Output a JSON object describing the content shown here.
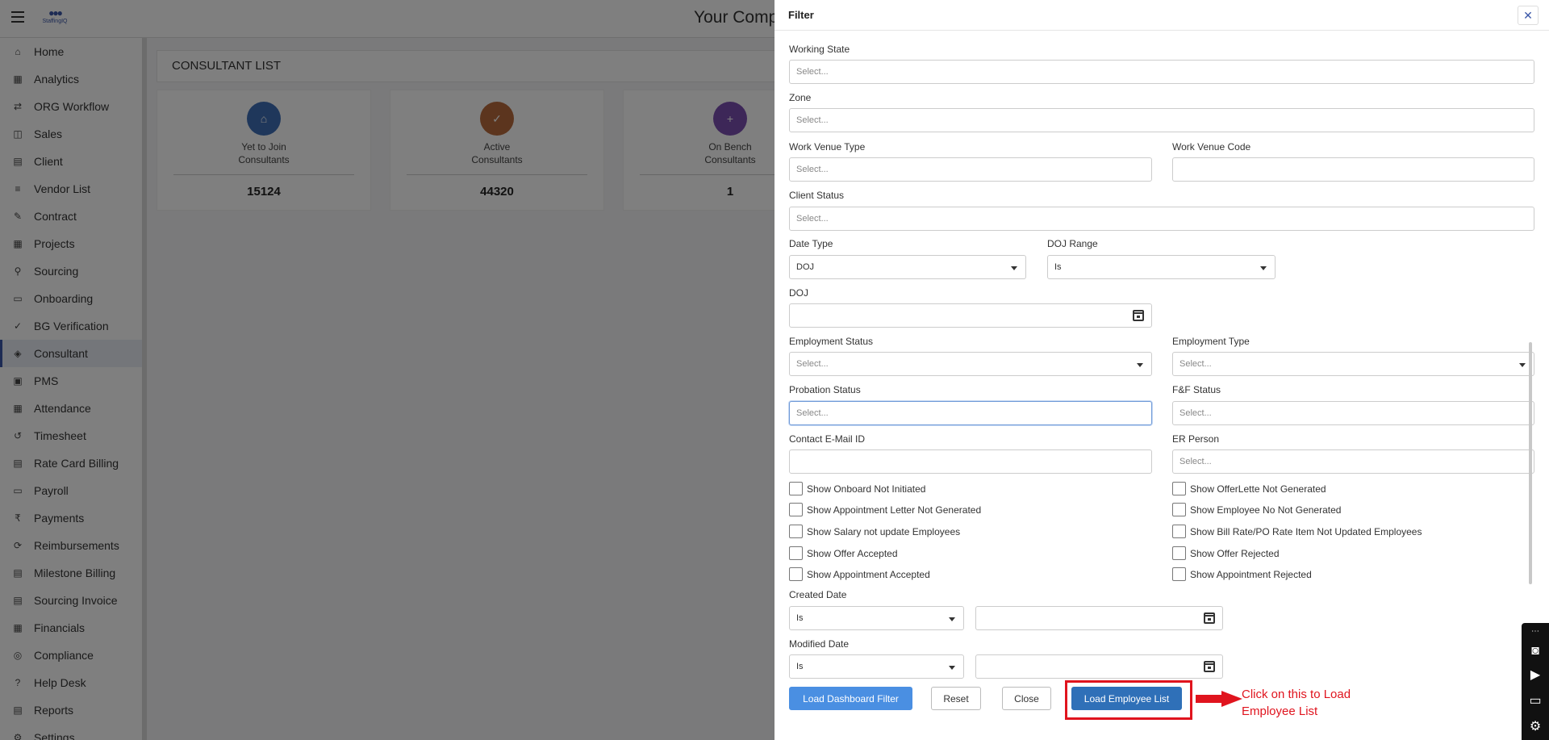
{
  "topbar": {
    "logo_text": "StaffingIQ",
    "company_title": "Your Comp"
  },
  "sidebar": {
    "items": [
      {
        "label": "Home",
        "icon": "home-icon"
      },
      {
        "label": "Analytics",
        "icon": "analytics-icon"
      },
      {
        "label": "ORG Workflow",
        "icon": "workflow-icon"
      },
      {
        "label": "Sales",
        "icon": "sales-icon"
      },
      {
        "label": "Client",
        "icon": "client-icon"
      },
      {
        "label": "Vendor List",
        "icon": "vendor-icon"
      },
      {
        "label": "Contract",
        "icon": "contract-icon"
      },
      {
        "label": "Projects",
        "icon": "projects-icon"
      },
      {
        "label": "Sourcing",
        "icon": "sourcing-icon"
      },
      {
        "label": "Onboarding",
        "icon": "onboarding-icon"
      },
      {
        "label": "BG Verification",
        "icon": "verification-icon"
      },
      {
        "label": "Consultant",
        "icon": "consultant-icon",
        "active": true
      },
      {
        "label": "PMS",
        "icon": "pms-icon"
      },
      {
        "label": "Attendance",
        "icon": "calendar-icon"
      },
      {
        "label": "Timesheet",
        "icon": "history-icon"
      },
      {
        "label": "Rate Card Billing",
        "icon": "billing-icon"
      },
      {
        "label": "Payroll",
        "icon": "payroll-icon"
      },
      {
        "label": "Payments",
        "icon": "rupee-icon"
      },
      {
        "label": "Reimbursements",
        "icon": "reimbursement-icon"
      },
      {
        "label": "Milestone Billing",
        "icon": "milestone-icon"
      },
      {
        "label": "Sourcing Invoice",
        "icon": "invoice-icon"
      },
      {
        "label": "Financials",
        "icon": "financials-icon"
      },
      {
        "label": "Compliance",
        "icon": "compliance-icon"
      },
      {
        "label": "Help Desk",
        "icon": "help-icon"
      },
      {
        "label": "Reports",
        "icon": "reports-icon"
      },
      {
        "label": "Settings",
        "icon": "settings-icon"
      }
    ]
  },
  "main": {
    "title": "CONSULTANT LIST",
    "cards": [
      {
        "label_line1": "Yet to Join",
        "label_line2": "Consultants",
        "value": "15124",
        "color": "#3f6fb6"
      },
      {
        "label_line1": "Active",
        "label_line2": "Consultants",
        "value": "44320",
        "color": "#b86a3c"
      },
      {
        "label_line1": "On Bench",
        "label_line2": "Consultants",
        "value": "1",
        "color": "#7b4fb0"
      }
    ]
  },
  "filter": {
    "title": "Filter",
    "close_icon": "close-icon",
    "working_state": {
      "label": "Working State",
      "placeholder": "Select..."
    },
    "zone": {
      "label": "Zone",
      "placeholder": "Select..."
    },
    "work_venue_type": {
      "label": "Work Venue Type",
      "placeholder": "Select..."
    },
    "work_venue_code": {
      "label": "Work Venue Code",
      "value": ""
    },
    "client_status": {
      "label": "Client Status",
      "placeholder": "Select..."
    },
    "date_type": {
      "label": "Date Type",
      "value": "DOJ"
    },
    "doj_range": {
      "label": "DOJ Range",
      "value": "Is"
    },
    "doj": {
      "label": "DOJ",
      "value": ""
    },
    "employment_status": {
      "label": "Employment Status",
      "placeholder": "Select..."
    },
    "employment_type": {
      "label": "Employment Type",
      "placeholder": "Select..."
    },
    "probation_status": {
      "label": "Probation Status",
      "placeholder": "Select..."
    },
    "ff_status": {
      "label": "F&F Status",
      "placeholder": "Select..."
    },
    "contact_email": {
      "label": "Contact E-Mail ID",
      "value": ""
    },
    "er_person": {
      "label": "ER Person",
      "placeholder": "Select..."
    },
    "checkboxes_left": [
      "Show Onboard Not Initiated",
      "Show Appointment Letter Not Generated",
      "Show Salary not update Employees",
      "Show Offer Accepted",
      "Show Appointment Accepted"
    ],
    "checkboxes_right": [
      "Show OfferLette Not Generated",
      "Show Employee No Not Generated",
      "Show Bill Rate/PO Rate Item Not Updated Employees",
      "Show Offer Rejected",
      "Show Appointment Rejected"
    ],
    "created_date": {
      "label": "Created Date",
      "operator": "Is",
      "value": ""
    },
    "modified_date": {
      "label": "Modified Date",
      "operator": "Is",
      "value": ""
    },
    "buttons": {
      "load_dashboard": "Load Dashboard Filter",
      "reset": "Reset",
      "close": "Close",
      "load_employee": "Load Employee List"
    },
    "annotation": "Click on this to Load Employee List"
  },
  "colors": {
    "accent": "#3a56a8",
    "primary_button": "#2f70b8",
    "highlight": "#e0141e"
  }
}
